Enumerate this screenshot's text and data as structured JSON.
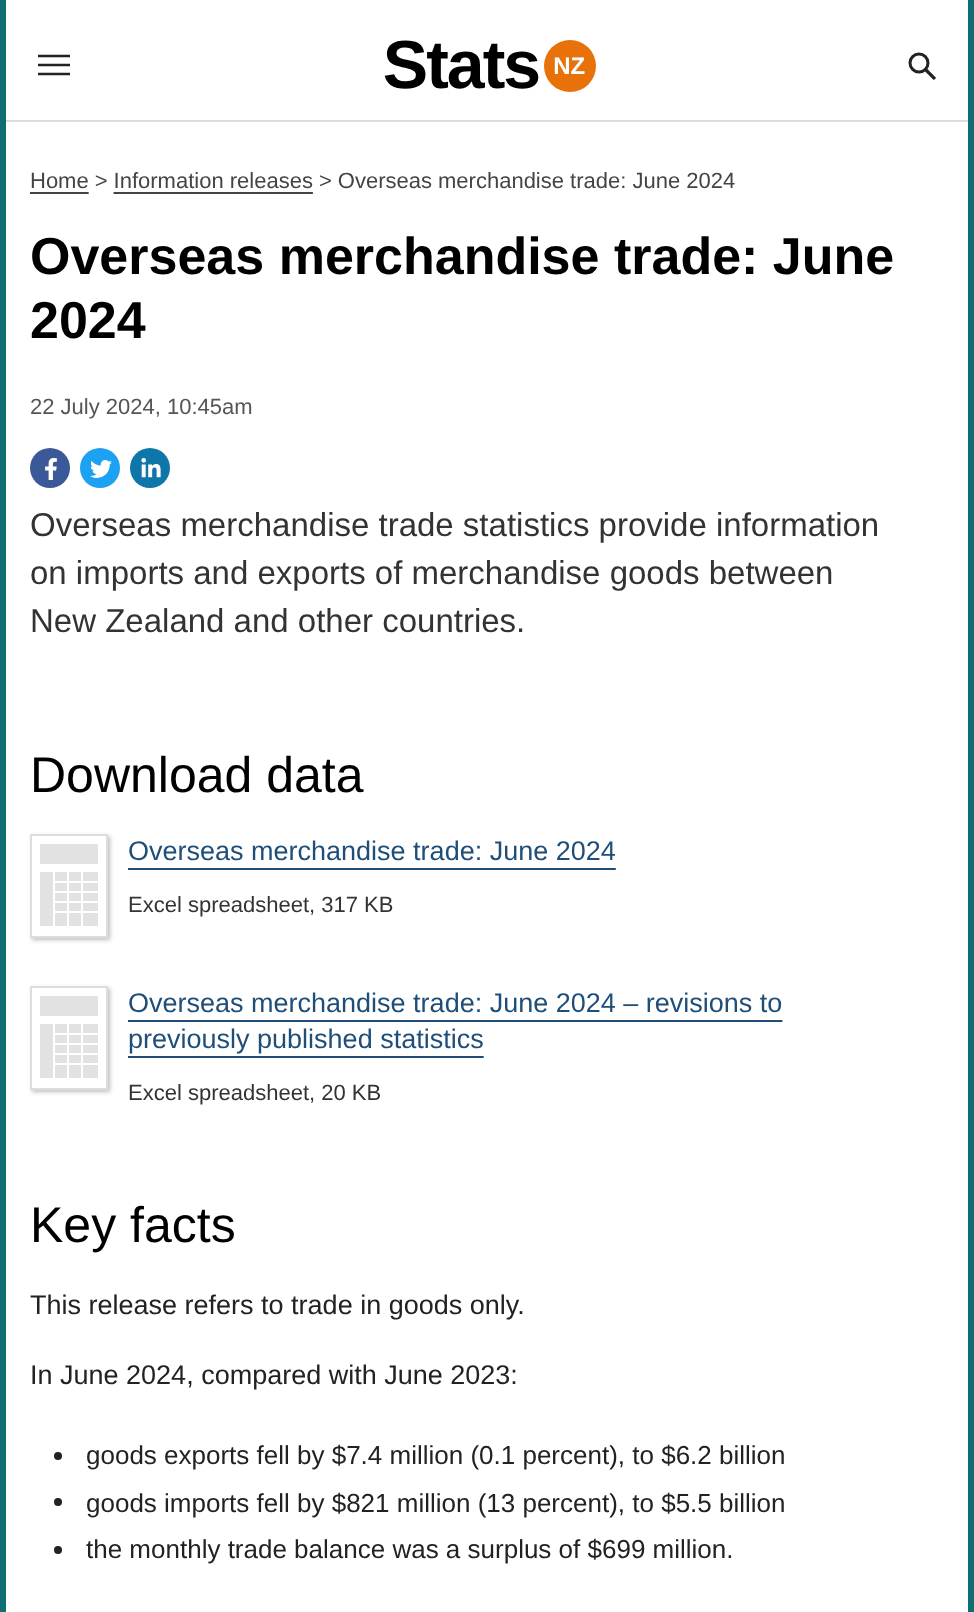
{
  "header": {
    "logo_word": "Stats",
    "logo_badge": "NZ"
  },
  "breadcrumb": [
    {
      "label": "Home",
      "link": true
    },
    {
      "label": "Information releases",
      "link": true
    },
    {
      "label": "Overseas merchandise trade: June 2024",
      "link": false
    }
  ],
  "breadcrumb_separator": ">",
  "title": "Overseas merchandise trade: June 2024",
  "date": "22 July 2024, 10:45am",
  "intro": "Overseas merchandise trade statistics provide information on imports and exports of merchandise goods between New Zealand and other countries.",
  "download": {
    "heading": "Download data",
    "files": [
      {
        "title": "Overseas merchandise trade: June 2024",
        "meta": "Excel spreadsheet, 317 KB"
      },
      {
        "title": "Overseas merchandise trade: June 2024 – revisions to previously published statistics",
        "meta": "Excel spreadsheet, 20 KB"
      }
    ]
  },
  "key_facts": {
    "heading": "Key facts",
    "paragraphs": [
      "This release refers to trade in goods only.",
      "In June 2024, compared with June 2023:"
    ],
    "bullets": [
      "goods exports fell by $7.4 million (0.1 percent), to $6.2 billion",
      "goods imports fell by $821 million (13 percent), to $5.5 billion",
      "the monthly trade balance was a surplus of $699 million."
    ]
  }
}
